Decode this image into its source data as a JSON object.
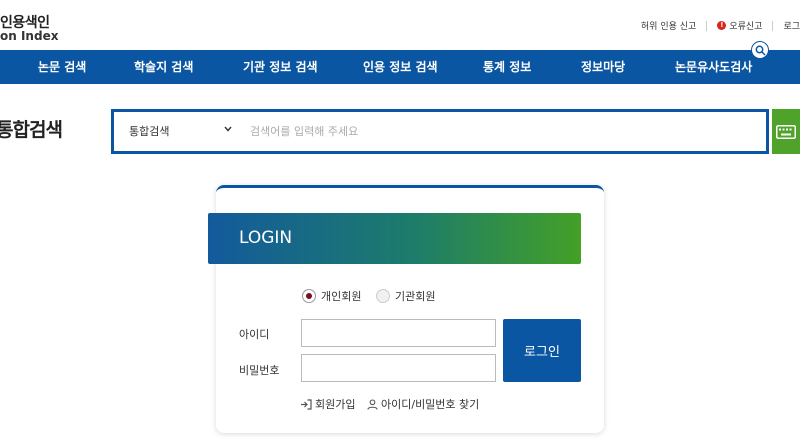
{
  "header": {
    "logo_line1": "인용색인",
    "logo_line2": "on Index",
    "util_links": [
      "허위 인용 신고",
      "오류신고",
      "로그"
    ]
  },
  "gnb": {
    "items": [
      "논문 검색",
      "학술지 검색",
      "기관 정보 검색",
      "인용 정보 검색",
      "통계 정보",
      "정보마당",
      "논문유사도검사"
    ]
  },
  "search": {
    "page_title": "통합검색",
    "select_value": "통합검색",
    "placeholder": "검색어를 입력해 주세요",
    "accent_color": "#0b56a3",
    "keyboard_button_color": "#4fa32b"
  },
  "login": {
    "title": "LOGIN",
    "member_types": [
      "개인회원",
      "기관회원"
    ],
    "selected_member_type": "개인회원",
    "id_label": "아이디",
    "password_label": "비밀번호",
    "submit_label": "로그인",
    "links": [
      "회원가입",
      "아이디/비밀번호 찾기"
    ]
  }
}
